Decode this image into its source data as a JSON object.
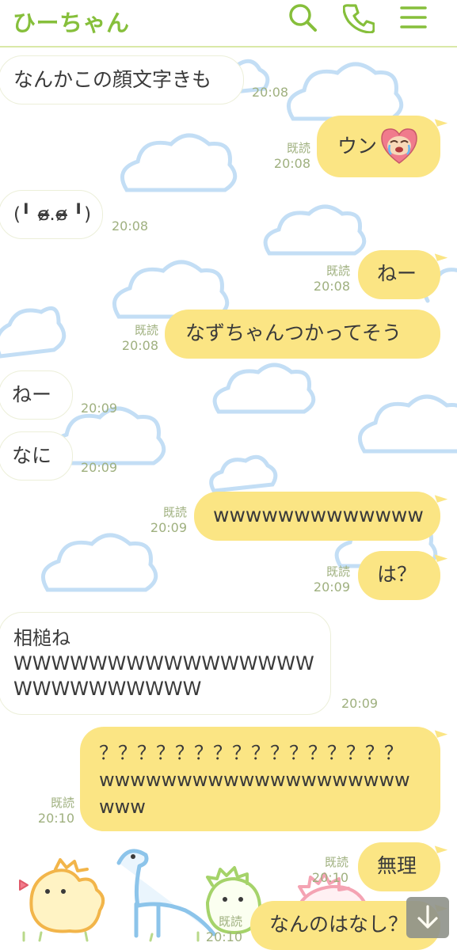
{
  "header": {
    "title": "ひーちゃん",
    "accent": "#86bf3b"
  },
  "messages": [
    {
      "side": "in",
      "text": "なんかこの顔文字きも",
      "time": "20:08"
    },
    {
      "side": "out",
      "text": "ウン",
      "read": "既読",
      "time": "20:08",
      "sticker": "crying-heart-emoji"
    },
    {
      "side": "in",
      "text": "(╹ ɞ̴̶̷.ɞ̴̶̷ ╹)",
      "time": "20:08"
    },
    {
      "side": "out",
      "text": "ねー",
      "read": "既読",
      "time": "20:08"
    },
    {
      "side": "out",
      "text": "なずちゃんつかってそう",
      "read": "既読",
      "time": "20:08"
    },
    {
      "side": "in",
      "text": "ねー",
      "time": "20:09"
    },
    {
      "side": "in",
      "text": "なに",
      "time": "20:09"
    },
    {
      "side": "out",
      "text": "wwwwwwwwwwwww",
      "read": "既読",
      "time": "20:09"
    },
    {
      "side": "out",
      "text": "は？",
      "read": "既読",
      "time": "20:09"
    },
    {
      "side": "in",
      "lines": [
        "相槌ね",
        "WWWWWWWWWWWWWWWW",
        "WWWWWWWWWW"
      ],
      "time": "20:09"
    },
    {
      "side": "out",
      "lines": [
        "？？？？？？？？？？？？？？？？",
        "wwwwwwwwwwwwwwwwwwww",
        "www"
      ],
      "read": "既読",
      "time": "20:10"
    },
    {
      "side": "out",
      "text": "無理",
      "read": "既読",
      "time": "20:10"
    },
    {
      "side": "out",
      "text": "なんのはなし？",
      "read": "既読",
      "time": "20:10"
    }
  ],
  "colors": {
    "out_bubble": "#fbe584",
    "in_bubble": "#ffffff",
    "meta_text": "#9fb07f",
    "cloud": "#bcdcf4"
  }
}
